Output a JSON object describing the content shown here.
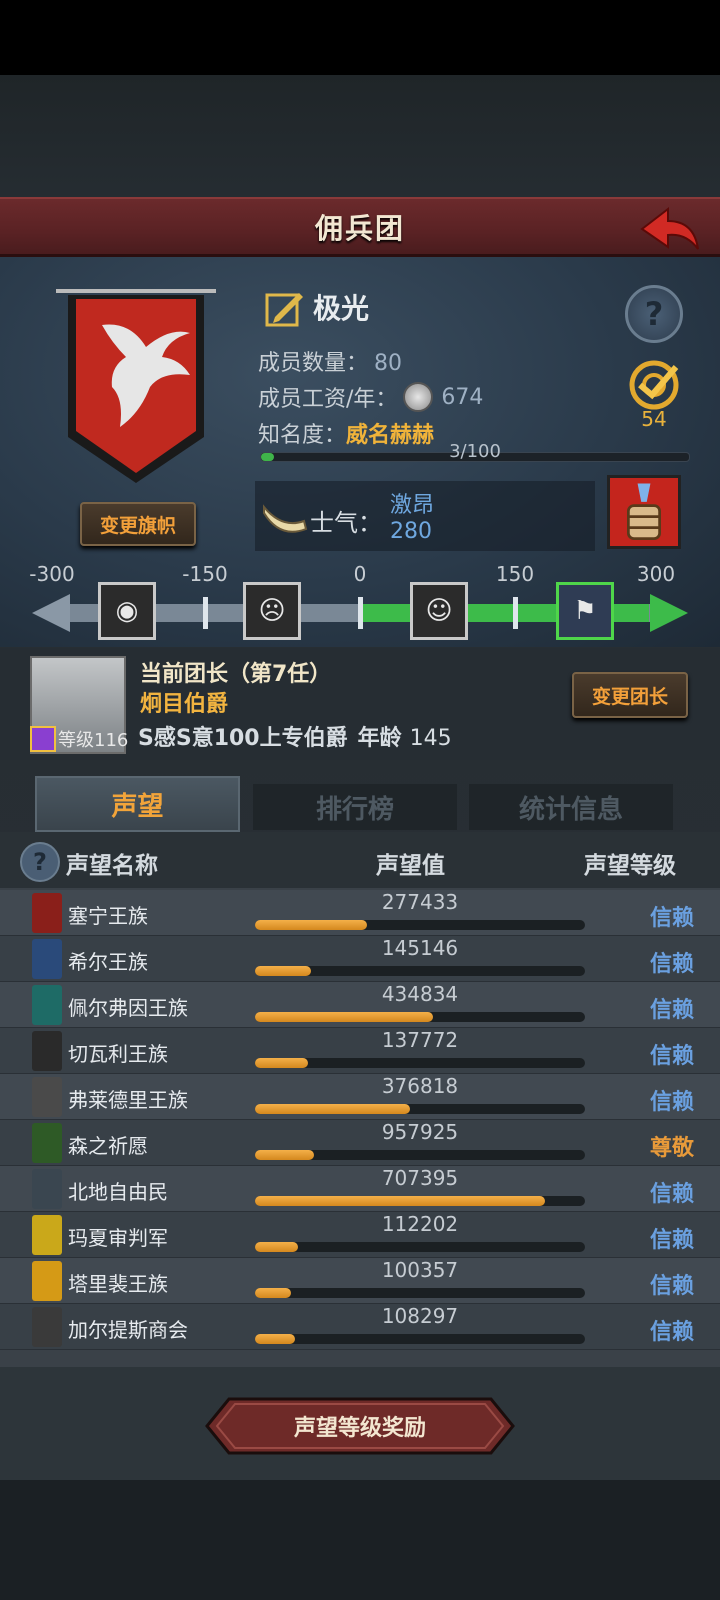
{
  "header": {
    "title": "佣兵团"
  },
  "guild": {
    "name": "极光",
    "members_label": "成员数量：",
    "members_value": "80",
    "wage_label": "成员工资/年：",
    "wage_value": "674",
    "fame_label": "知名度：",
    "fame_value": "威名赫赫",
    "fame_progress_text": "3/100",
    "fame_progress": 0.03,
    "target_count": "54",
    "change_flag_label": "变更旗帜"
  },
  "morale": {
    "label": "士气：",
    "state": "激昂",
    "value": "280",
    "scale_labels": [
      "-300",
      "-150",
      "0",
      "150",
      "300"
    ],
    "scale_min": -300,
    "scale_max": 300,
    "scale_current": 280
  },
  "leader": {
    "title": "当前团长（第7任）",
    "name": "炯目伯爵",
    "level_text": "等级116",
    "tags": "S感S意100上专伯爵",
    "age_label": "年龄",
    "age_value": "145",
    "change_label": "变更团长"
  },
  "tabs": [
    {
      "label": "声望",
      "active": true
    },
    {
      "label": "排行榜",
      "active": false
    },
    {
      "label": "统计信息",
      "active": false
    }
  ],
  "table": {
    "headers": {
      "name": "声望名称",
      "value": "声望值",
      "level": "声望等级"
    },
    "rows": [
      {
        "name": "塞宁王族",
        "value": "277433",
        "fill": 0.34,
        "level": "信赖",
        "color": "#8a1f1a"
      },
      {
        "name": "希尔王族",
        "value": "145146",
        "fill": 0.17,
        "level": "信赖",
        "color": "#2a4a7a"
      },
      {
        "name": "佩尔弗因王族",
        "value": "434834",
        "fill": 0.54,
        "level": "信赖",
        "color": "#1e6b66"
      },
      {
        "name": "切瓦利王族",
        "value": "137772",
        "fill": 0.16,
        "level": "信赖",
        "color": "#2a2a2a"
      },
      {
        "name": "弗莱德里王族",
        "value": "376818",
        "fill": 0.47,
        "level": "信赖",
        "color": "#4a4a4a"
      },
      {
        "name": "森之祈愿",
        "value": "957925",
        "fill": 0.18,
        "level": "尊敬",
        "color": "#2e5a26"
      },
      {
        "name": "北地自由民",
        "value": "707395",
        "fill": 0.88,
        "level": "信赖",
        "color": "#3a4650"
      },
      {
        "name": "玛夏审判军",
        "value": "112202",
        "fill": 0.13,
        "level": "信赖",
        "color": "#caa81a"
      },
      {
        "name": "塔里裴王族",
        "value": "100357",
        "fill": 0.11,
        "level": "信赖",
        "color": "#d59a16"
      },
      {
        "name": "加尔提斯商会",
        "value": "108297",
        "fill": 0.12,
        "level": "信赖",
        "color": "#3a3a3a"
      }
    ]
  },
  "footer": {
    "reward_label": "声望等级奖励"
  }
}
